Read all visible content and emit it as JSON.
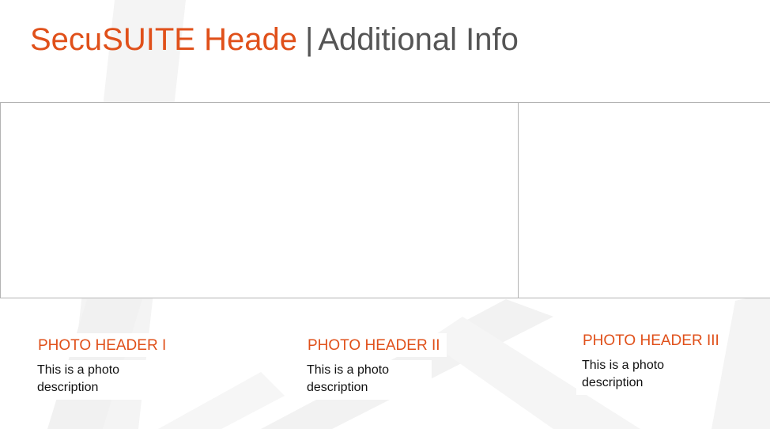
{
  "header": {
    "title_part_a": "SecuSUITE Heade",
    "title_separator": "|",
    "title_part_b": "Additional Info"
  },
  "photos": [
    {
      "header": "PHOTO HEADER I",
      "description": "This is a photo description"
    },
    {
      "header": "PHOTO HEADER II",
      "description": "This is a photo description"
    },
    {
      "header": "PHOTO HEADER III",
      "description": "This is a photo description"
    }
  ],
  "colors": {
    "accent": "#e0501a",
    "text_gray": "#555555",
    "border": "#b3b3b3",
    "background_shape": "#f3f3f3"
  }
}
